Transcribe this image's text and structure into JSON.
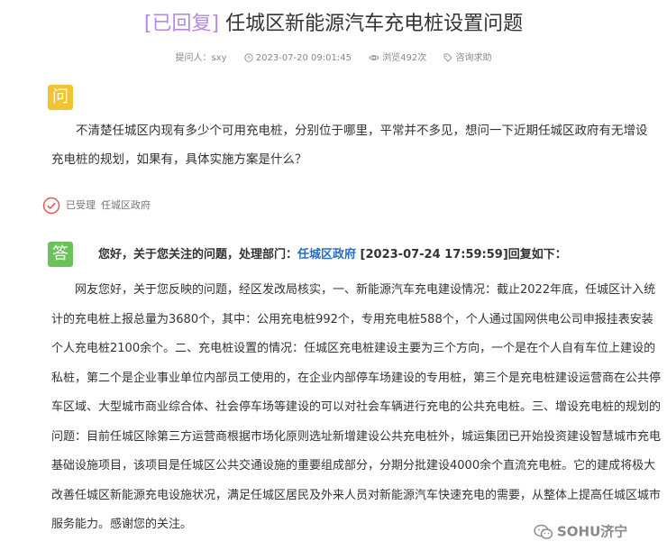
{
  "title": {
    "status": "[已回复]",
    "text": " 任城区新能源汽车充电桩设置问题"
  },
  "meta": {
    "asker": "提问人：sxy",
    "time": "2023-07-20 09:01:45",
    "views": "浏览492次",
    "category": "咨询求助"
  },
  "question": {
    "badge": "问",
    "text": "不清楚任城区内现有多少个可用充电桩，分别位于哪里，平常并不多见，想问一下近期任城区政府有无增设充电桩的规划，如果有，具体实施方案是什么？"
  },
  "accepted": {
    "status": "已受理",
    "department": "任城区政府"
  },
  "answer": {
    "badge": "答",
    "head_prefix": "您好，关于您关注的问题，处理部门：",
    "department": "任城区政府",
    "head_suffix": " [2023-07-24 17:59:59]回复如下：",
    "body": "网友您好，关于您反映的问题，经区发改局核实，一、新能源汽车充电建设情况：截止2022年底，任城区计入统计的充电桩上报总量为3680个，其中：公用充电桩992个，专用充电桩588个，个人通过国网供电公司申报挂表安装个人充电桩2100余个。二、充电桩设置的情况：任城区充电桩建设主要为三个方向，一个是在个人自有车位上建设的私桩，第二个是企业事业单位内部员工使用的，在企业内部停车场建设的专用桩，第三个是充电桩建设运营商在公共停车区域、大型城市商业综合体、社会停车场等建设的可以对社会车辆进行充电的公共充电桩。三、增设充电桩的规划的问题：目前任城区除第三方运营商根据市场化原则选址新增建设公共充电桩外，城运集团已开始投资建设智慧城市充电基础设施项目，该项目是任城区公共交通设施的重要组成部分，分期分批建设4000余个直流充电桩。它的建成将极大改善任城区新能源充电设施状况，满足任城区居民及外来人员对新能源汽车快速充电的需要，从整体上提高任城区城市服务能力。感谢您的关注。"
  },
  "watermark": {
    "text": "SOHU济宁"
  },
  "colors": {
    "status_purple": "#b58ae6",
    "question_badge": "#f2c433",
    "answer_badge": "#6cc25a",
    "accepted_red": "#e05a5a",
    "link_blue": "#2b6cc4"
  },
  "icons": {
    "time": "clock-icon",
    "views": "eye-icon",
    "category": "tag-icon",
    "accepted": "check-circle-icon",
    "watermark": "wechat-icon"
  }
}
